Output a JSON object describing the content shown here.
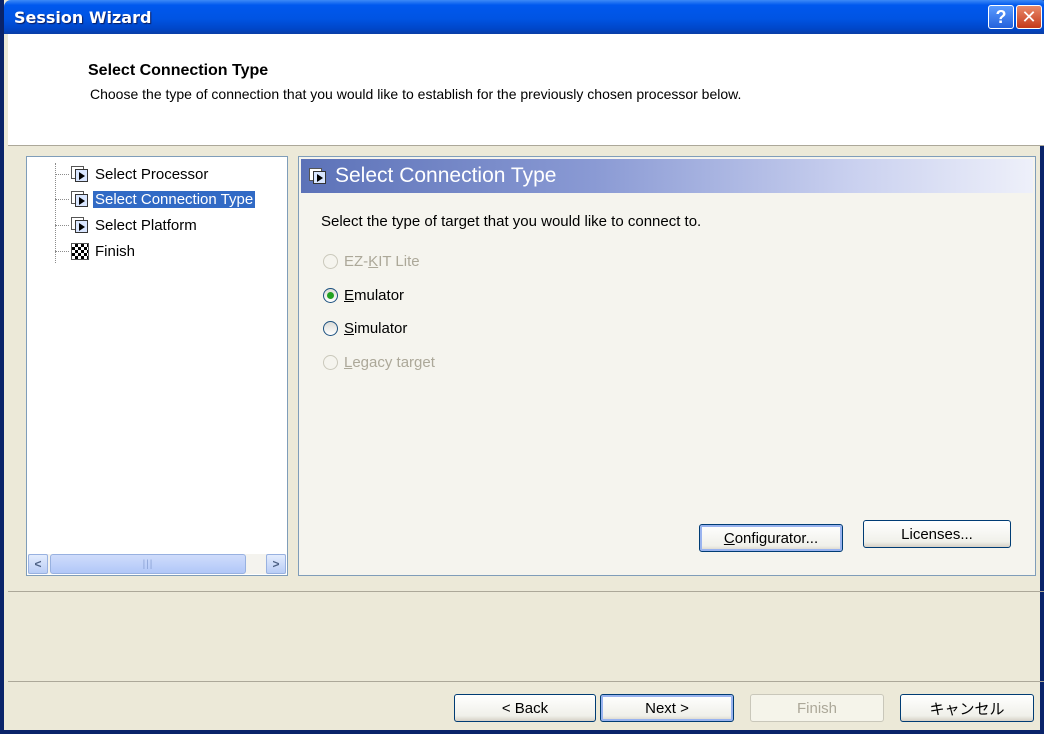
{
  "window": {
    "title": "Session Wizard",
    "help_label": "?",
    "close_label": "✕"
  },
  "header": {
    "title": "Select Connection Type",
    "subtitle": "Choose the type of connection that you would like to establish for the previously chosen processor below."
  },
  "tree": {
    "items": [
      {
        "label": "Select Processor",
        "icon": "page-icon"
      },
      {
        "label": "Select Connection Type",
        "icon": "page-icon",
        "selected": true
      },
      {
        "label": "Select Platform",
        "icon": "page-icon"
      },
      {
        "label": "Finish",
        "icon": "checkered-flag-icon"
      }
    ],
    "scroll_left": "<",
    "scroll_right": ">",
    "scroll_grip": "|||"
  },
  "panel": {
    "title": "Select Connection Type",
    "instruction": "Select the type of target that you would like to connect to.",
    "options": [
      {
        "pre": "EZ-",
        "mn": "K",
        "post": "IT Lite",
        "checked": false,
        "disabled": true
      },
      {
        "pre": "",
        "mn": "E",
        "post": "mulator",
        "checked": true,
        "disabled": false
      },
      {
        "pre": "",
        "mn": "S",
        "post": "imulator",
        "checked": false,
        "disabled": false
      },
      {
        "pre": "",
        "mn": "L",
        "post": "egacy target",
        "checked": false,
        "disabled": true
      }
    ],
    "configurator_mn": "C",
    "configurator_rest": "onfigurator...",
    "licenses_label": "Licenses..."
  },
  "footer": {
    "back_label": "< Back",
    "next_label": "Next >",
    "finish_label": "Finish",
    "cancel_label": "キャンセル"
  }
}
